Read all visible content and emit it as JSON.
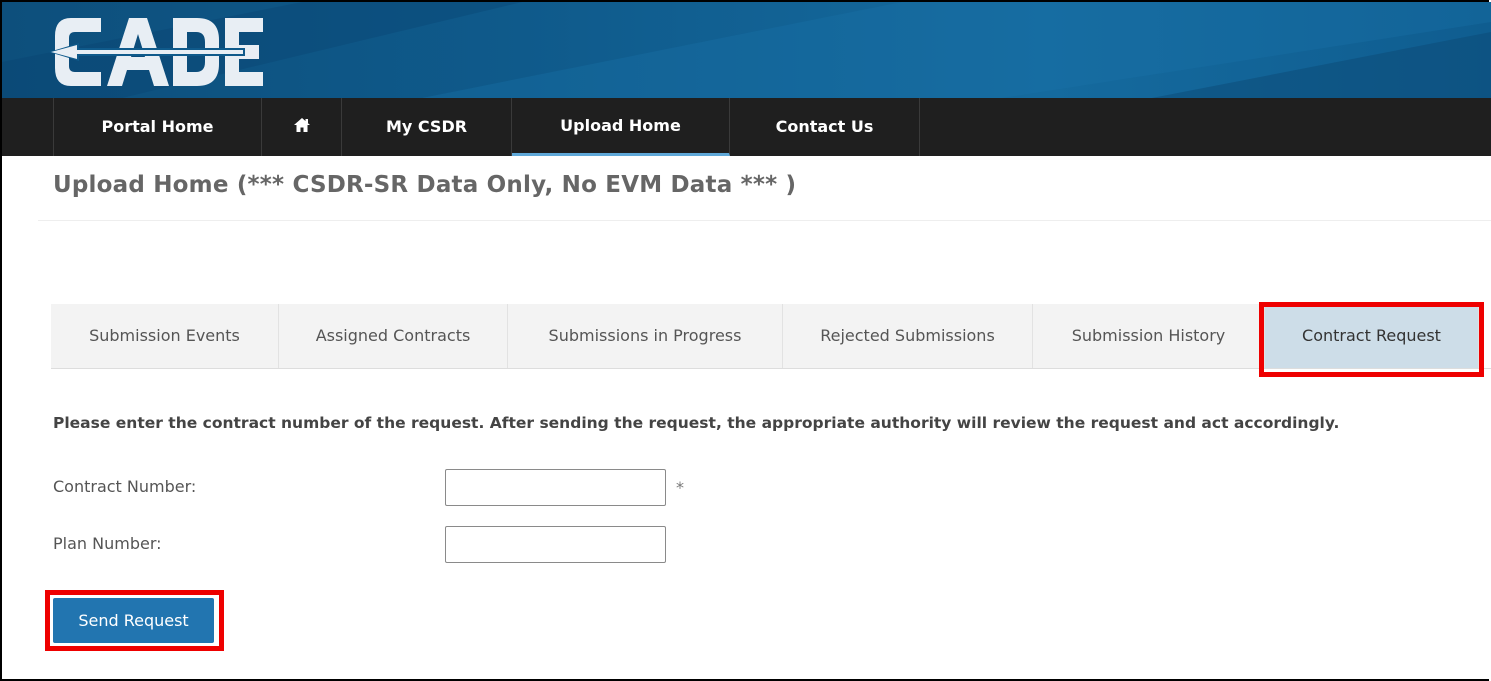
{
  "logo": {
    "text": "CADE"
  },
  "nav": {
    "items": [
      {
        "label": "Portal Home"
      },
      {
        "label": "",
        "icon": "home-icon"
      },
      {
        "label": "My CSDR"
      },
      {
        "label": "Upload Home",
        "active": true
      },
      {
        "label": "Contact Us"
      }
    ]
  },
  "page": {
    "title": "Upload Home (*** CSDR-SR Data Only, No EVM Data *** )"
  },
  "tabs": [
    {
      "label": "Submission Events"
    },
    {
      "label": "Assigned Contracts"
    },
    {
      "label": "Submissions in Progress"
    },
    {
      "label": "Rejected Submissions"
    },
    {
      "label": "Submission History"
    },
    {
      "label": "Contract Request",
      "selected": true
    }
  ],
  "form": {
    "instructions": "Please enter the contract number of the request. After sending the request, the appropriate authority will review the request and act accordingly.",
    "contract_number_label": "Contract Number:",
    "contract_number_value": "",
    "required_marker": "*",
    "plan_number_label": "Plan Number:",
    "plan_number_value": "",
    "send_button": "Send Request"
  },
  "colors": {
    "banner": "#0f5a8b",
    "nav": "#1f1f1f",
    "active_underline": "#5fa8d8",
    "tab_selected": "#cddde8",
    "button": "#2275b0",
    "highlight": "#ee0000"
  }
}
